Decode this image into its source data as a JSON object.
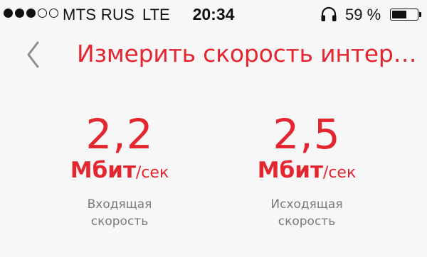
{
  "status_bar": {
    "signal_dots": [
      true,
      true,
      true,
      false,
      false
    ],
    "carrier": "MTS RUS",
    "network": "LTE",
    "time": "20:34",
    "headphones_icon": "headphones-icon",
    "battery_percent": "59 %",
    "battery_level": 0.59
  },
  "nav": {
    "back_icon": "chevron-left-icon",
    "title": "Измерить скорость интернет"
  },
  "colors": {
    "accent": "#e3262f",
    "label": "#7a7a7a",
    "background": "#f7f7f7"
  },
  "speeds": {
    "incoming": {
      "value": "2,2",
      "unit_main": "Мбит",
      "unit_sub": "/сек",
      "label_line1": "Входящая",
      "label_line2": "скорость"
    },
    "outgoing": {
      "value": "2,5",
      "unit_main": "Мбит",
      "unit_sub": "/сек",
      "label_line1": "Исходящая",
      "label_line2": "скорость"
    }
  }
}
